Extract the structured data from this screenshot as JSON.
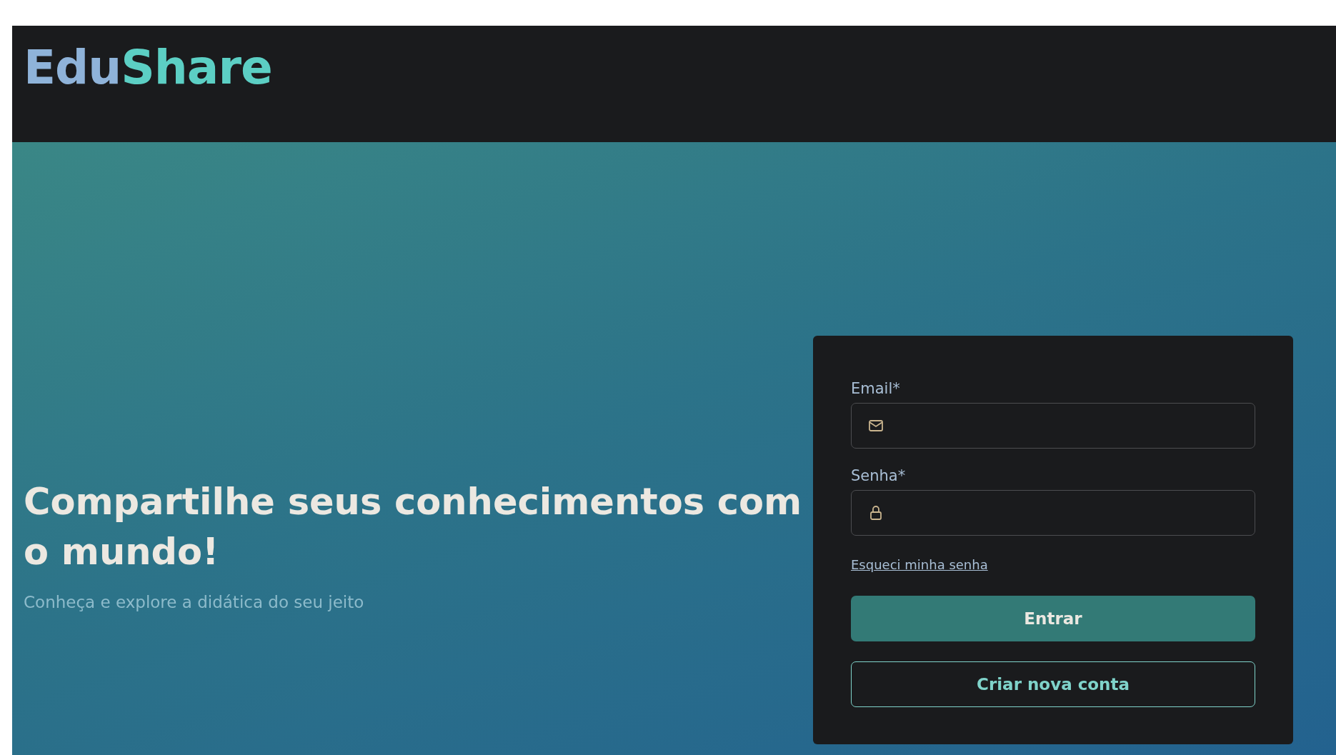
{
  "logo": {
    "parts": [
      {
        "text": "Edu",
        "color": "#8fb3d9"
      },
      {
        "text": "Share",
        "color": "#5ccfc4"
      }
    ]
  },
  "hero": {
    "headline": "Compartilhe seus conhecimentos com o mundo!",
    "subtitle": "Conheça e explore a didática do seu jeito"
  },
  "login_form": {
    "fields": [
      {
        "label": "Email*",
        "kind": "email"
      },
      {
        "label": "Senha*",
        "kind": "password"
      }
    ],
    "forgot_link": "Esqueci minha senha",
    "buttons": [
      {
        "label": "Entrar",
        "kind": "primary"
      },
      {
        "label": "Criar nova conta",
        "kind": "outline"
      }
    ]
  }
}
